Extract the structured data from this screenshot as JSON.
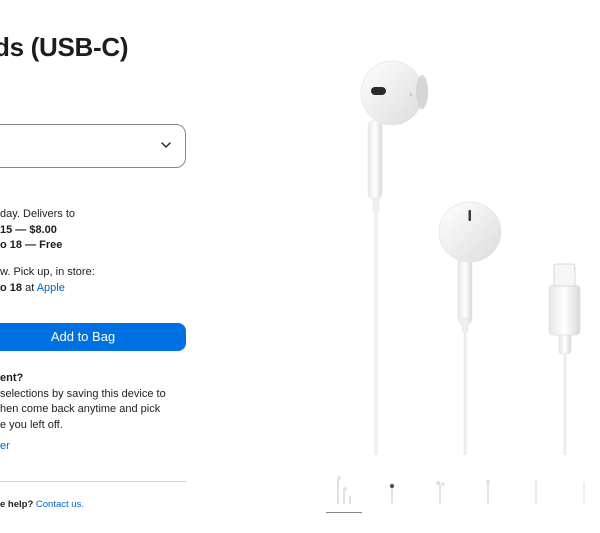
{
  "product": {
    "title": "ds (USB-C)"
  },
  "delivery": {
    "line1": "day. Delivers to",
    "line2": "15 — $8.00",
    "line3": "o 18 — Free"
  },
  "pickup": {
    "line1": "w. Pick up, in store:",
    "line2_bold": "o 18",
    "line2_mid": " at ",
    "line2_link": "Apple"
  },
  "actions": {
    "add_to_bag": "Add to Bag"
  },
  "save": {
    "title": "ent?",
    "line1": "selections by saving this device to",
    "line2": "hen come back anytime and pick",
    "line3": "e you left off.",
    "link": "er"
  },
  "help": {
    "prefix": "e help? ",
    "link": "Contact us."
  },
  "colors": {
    "accent": "#0071e3",
    "link": "#0066cc",
    "text": "#1d1d1f"
  },
  "icons": {
    "select_chevron": "chevron-down-icon"
  }
}
